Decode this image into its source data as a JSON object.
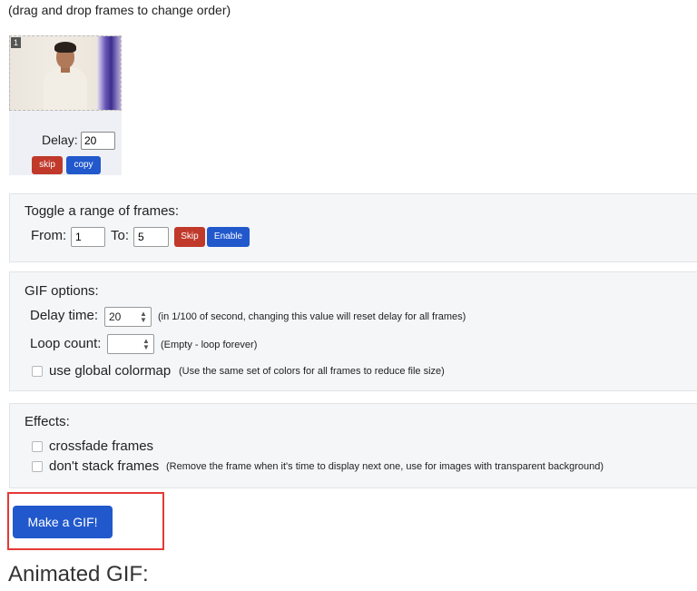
{
  "hint": "(drag and drop frames to change order)",
  "frame": {
    "number": "1",
    "delay_label": "Delay:",
    "delay_value": "20",
    "skip_label": "skip",
    "copy_label": "copy"
  },
  "toggle_range": {
    "title": "Toggle a range of frames:",
    "from_label": "From:",
    "from_value": "1",
    "to_label": "To:",
    "to_value": "5",
    "skip_label": "Skip",
    "enable_label": "Enable"
  },
  "gif_options": {
    "title": "GIF options:",
    "delay_label": "Delay time:",
    "delay_value": "20",
    "delay_note": "(in 1/100 of second, changing this value will reset delay for all frames)",
    "loop_label": "Loop count:",
    "loop_value": "",
    "loop_note": "(Empty - loop forever)",
    "colormap_label": "use global colormap",
    "colormap_note": "(Use the same set of colors for all frames to reduce file size)"
  },
  "effects": {
    "title": "Effects:",
    "crossfade_label": "crossfade frames",
    "nostack_label": "don't stack frames",
    "nostack_note": "(Remove the frame when it's time to display next one, use for images with transparent background)"
  },
  "make_gif_label": "Make a GIF!",
  "animated_title": "Animated GIF:",
  "colors": {
    "primary": "#2158cc",
    "danger": "#c0392b",
    "highlight": "#e53935"
  }
}
